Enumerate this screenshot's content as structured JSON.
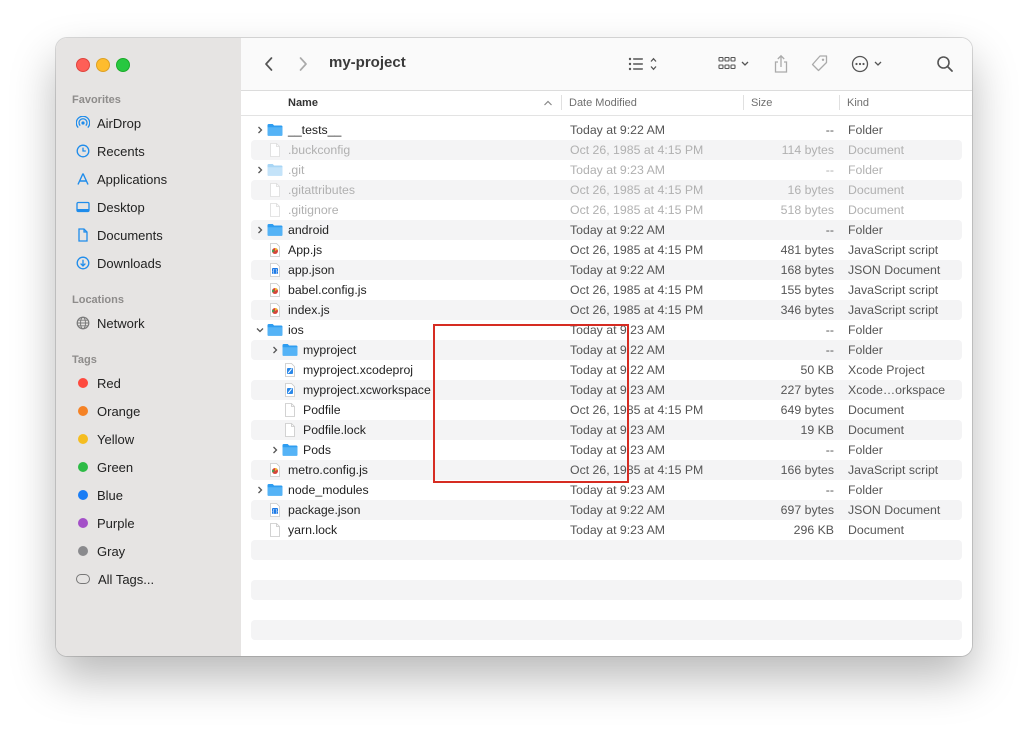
{
  "window": {
    "title": "my-project",
    "colors": {
      "close": "#fe5f57",
      "minimize": "#febc2e",
      "zoom": "#28c840",
      "accent": "#1f8ceb",
      "annotation": "#d62c22"
    }
  },
  "toolbar": {
    "back_icon": "chevron-left-icon",
    "forward_icon": "chevron-right-icon",
    "list_view_icon": "list-view-icon",
    "group_icon": "grid-group-icon",
    "share_icon": "share-icon",
    "tag_icon": "tag-icon",
    "more_icon": "ellipsis-circle-icon",
    "search_icon": "search-icon"
  },
  "sidebar": {
    "favorites_label": "Favorites",
    "favorites": [
      {
        "label": "AirDrop",
        "icon": "airdrop-icon"
      },
      {
        "label": "Recents",
        "icon": "clock-icon"
      },
      {
        "label": "Applications",
        "icon": "applications-icon"
      },
      {
        "label": "Desktop",
        "icon": "desktop-icon"
      },
      {
        "label": "Documents",
        "icon": "document-icon"
      },
      {
        "label": "Downloads",
        "icon": "download-icon"
      }
    ],
    "locations_label": "Locations",
    "locations": [
      {
        "label": "Network",
        "icon": "network-icon"
      }
    ],
    "tags_label": "Tags",
    "tags": [
      {
        "label": "Red",
        "color": "#fe4a3f"
      },
      {
        "label": "Orange",
        "color": "#f58225"
      },
      {
        "label": "Yellow",
        "color": "#f5bd20"
      },
      {
        "label": "Green",
        "color": "#2dbb46"
      },
      {
        "label": "Blue",
        "color": "#1a7df5"
      },
      {
        "label": "Purple",
        "color": "#a450c8"
      },
      {
        "label": "Gray",
        "color": "#8a8a8d"
      }
    ],
    "all_tags_label": "All Tags..."
  },
  "columns": {
    "name": "Name",
    "date_modified": "Date Modified",
    "size": "Size",
    "kind": "Kind"
  },
  "files": [
    {
      "name": "__tests__",
      "date": "Today at 9:22 AM",
      "size": "--",
      "kind": "Folder",
      "type": "folder",
      "indent": 0,
      "expandable": "collapsed",
      "hidden": false
    },
    {
      "name": ".buckconfig",
      "date": "Oct 26, 1985 at 4:15 PM",
      "size": "114 bytes",
      "kind": "Document",
      "type": "doc",
      "indent": 0,
      "expandable": "none",
      "hidden": true
    },
    {
      "name": ".git",
      "date": "Today at 9:23 AM",
      "size": "--",
      "kind": "Folder",
      "type": "folder",
      "indent": 0,
      "expandable": "collapsed",
      "hidden": true
    },
    {
      "name": ".gitattributes",
      "date": "Oct 26, 1985 at 4:15 PM",
      "size": "16 bytes",
      "kind": "Document",
      "type": "doc",
      "indent": 0,
      "expandable": "none",
      "hidden": true
    },
    {
      "name": ".gitignore",
      "date": "Oct 26, 1985 at 4:15 PM",
      "size": "518 bytes",
      "kind": "Document",
      "type": "doc",
      "indent": 0,
      "expandable": "none",
      "hidden": true
    },
    {
      "name": "android",
      "date": "Today at 9:22 AM",
      "size": "--",
      "kind": "Folder",
      "type": "folder",
      "indent": 0,
      "expandable": "collapsed",
      "hidden": false
    },
    {
      "name": "App.js",
      "date": "Oct 26, 1985 at 4:15 PM",
      "size": "481 bytes",
      "kind": "JavaScript script",
      "type": "js",
      "indent": 0,
      "expandable": "none",
      "hidden": false
    },
    {
      "name": "app.json",
      "date": "Today at 9:22 AM",
      "size": "168 bytes",
      "kind": "JSON Document",
      "type": "json",
      "indent": 0,
      "expandable": "none",
      "hidden": false
    },
    {
      "name": "babel.config.js",
      "date": "Oct 26, 1985 at 4:15 PM",
      "size": "155 bytes",
      "kind": "JavaScript script",
      "type": "js",
      "indent": 0,
      "expandable": "none",
      "hidden": false
    },
    {
      "name": "index.js",
      "date": "Oct 26, 1985 at 4:15 PM",
      "size": "346 bytes",
      "kind": "JavaScript script",
      "type": "js",
      "indent": 0,
      "expandable": "none",
      "hidden": false
    },
    {
      "name": "ios",
      "date": "Today at 9:23 AM",
      "size": "--",
      "kind": "Folder",
      "type": "folder",
      "indent": 0,
      "expandable": "expanded",
      "hidden": false
    },
    {
      "name": "myproject",
      "date": "Today at 9:22 AM",
      "size": "--",
      "kind": "Folder",
      "type": "folder",
      "indent": 1,
      "expandable": "collapsed",
      "hidden": false
    },
    {
      "name": "myproject.xcodeproj",
      "date": "Today at 9:22 AM",
      "size": "50 KB",
      "kind": "Xcode Project",
      "type": "xcode",
      "indent": 1,
      "expandable": "none",
      "hidden": false
    },
    {
      "name": "myproject.xcworkspace",
      "date": "Today at 9:23 AM",
      "size": "227 bytes",
      "kind": "Xcode…orkspace",
      "type": "xcode",
      "indent": 1,
      "expandable": "none",
      "hidden": false
    },
    {
      "name": "Podfile",
      "date": "Oct 26, 1985 at 4:15 PM",
      "size": "649 bytes",
      "kind": "Document",
      "type": "doc",
      "indent": 1,
      "expandable": "none",
      "hidden": false
    },
    {
      "name": "Podfile.lock",
      "date": "Today at 9:23 AM",
      "size": "19 KB",
      "kind": "Document",
      "type": "doc",
      "indent": 1,
      "expandable": "none",
      "hidden": false
    },
    {
      "name": "Pods",
      "date": "Today at 9:23 AM",
      "size": "--",
      "kind": "Folder",
      "type": "folder",
      "indent": 1,
      "expandable": "collapsed",
      "hidden": false
    },
    {
      "name": "metro.config.js",
      "date": "Oct 26, 1985 at 4:15 PM",
      "size": "166 bytes",
      "kind": "JavaScript script",
      "type": "js",
      "indent": 0,
      "expandable": "none",
      "hidden": false
    },
    {
      "name": "node_modules",
      "date": "Today at 9:23 AM",
      "size": "--",
      "kind": "Folder",
      "type": "folder",
      "indent": 0,
      "expandable": "collapsed",
      "hidden": false
    },
    {
      "name": "package.json",
      "date": "Today at 9:22 AM",
      "size": "697 bytes",
      "kind": "JSON Document",
      "type": "json",
      "indent": 0,
      "expandable": "none",
      "hidden": false
    },
    {
      "name": "yarn.lock",
      "date": "Today at 9:23 AM",
      "size": "296 KB",
      "kind": "Document",
      "type": "doc",
      "indent": 0,
      "expandable": "none",
      "hidden": false
    }
  ]
}
